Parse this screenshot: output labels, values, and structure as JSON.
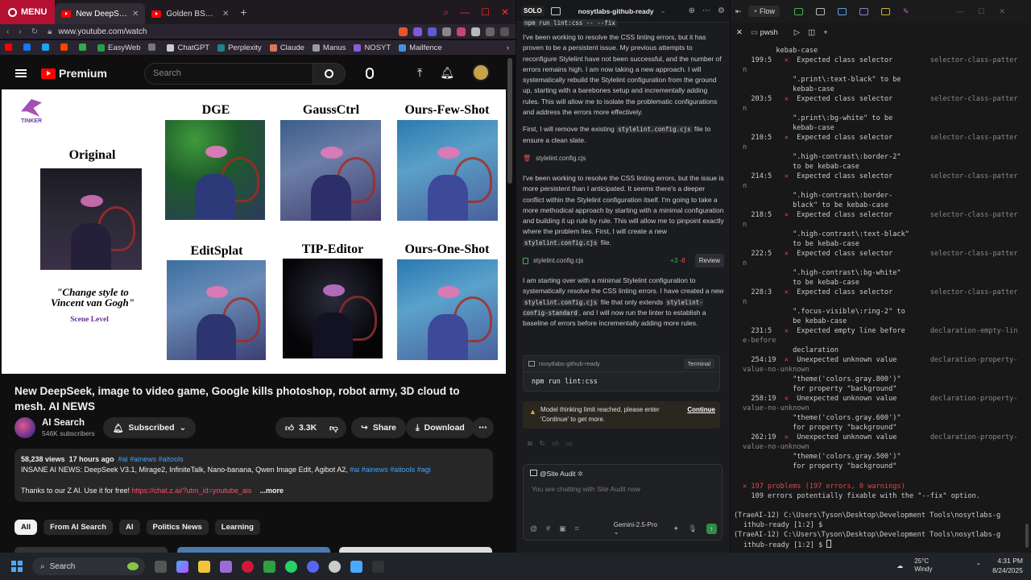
{
  "browser": {
    "menu_label": "MENU",
    "tabs": [
      {
        "title": "New DeepSeek, image"
      },
      {
        "title": "Golden BSP X Teo Laza"
      }
    ],
    "url": "www.youtube.com/watch",
    "bookmarks": [
      "EasyWeb",
      "ChatGPT",
      "Perplexity",
      "Claude",
      "Manus",
      "NOSYT",
      "Mailfence"
    ]
  },
  "youtube": {
    "logo_text": "Premium",
    "search_placeholder": "Search",
    "figure": {
      "brand": "TINKER",
      "original_label": "Original",
      "methods": [
        "DGE",
        "GaussCtrl",
        "Ours-Few-Shot",
        "EditSplat",
        "TIP-Editor",
        "Ours-One-Shot"
      ],
      "quote": "\"Change style to Vincent van Gogh\"",
      "scene_level": "Scene Level"
    },
    "video_title": "New DeepSeek, image to video game, Google kills photoshop, robot army, 3D cloud to mesh. AI NEWS",
    "channel": {
      "name": "AI Search",
      "subscribers": "546K subscribers",
      "subscribed_label": "Subscribed"
    },
    "actions": {
      "likes": "3.3K",
      "share": "Share",
      "download": "Download"
    },
    "description": {
      "views": "58,238 views",
      "age": "17 hours ago",
      "tags_line": "#ai #ainews #aitools",
      "text": "INSANE AI NEWS: DeepSeek V3.1, Mirage2, InfiniteTalk, Nano-banana, Qwen Image Edit, Agibot A2,",
      "tags_inline": "#ai #ainews #aitools #agi",
      "thanks": "Thanks to our Z AI. Use it for free!",
      "link": "https://chat.z.ai/?utm_id=youtube_ais",
      "more": "...more"
    },
    "chips": [
      "All",
      "From AI Search",
      "AI",
      "Politics News",
      "Learning"
    ]
  },
  "trae": {
    "solo": "SOLO",
    "repo": "nosytlabs-github-ready",
    "top_cmd": "npm run lint:css -- --fix",
    "p1": "I've been working to resolve the CSS linting errors, but it has proven to be a persistent issue. My previous attempts to reconfigure Stylelint have not been successful, and the number of errors remains high. I am now taking a new approach. I will systematically rebuild the Stylelint configuration from the ground up, starting with a barebones setup and incrementally adding rules. This will allow me to isolate the problematic configurations and address the errors more effectively.",
    "p2a": "First, I will remove the existing",
    "p2code": "stylelint.config.cjs",
    "p2b": "file to ensure a clean slate.",
    "file1": "stylelint.config.cjs",
    "p3a": "I've been working to resolve the CSS linting errors, but the issue is more persistent than I anticipated. It seems there's a deeper conflict within the Stylelint configuration itself. I'm going to take a more methodical approach by starting with a minimal configuration and building it up rule by rule. This will allow me to pinpoint exactly where the problem lies. First, I will create a new",
    "p3code": "stylelint.config.cjs",
    "p3b": "file.",
    "file2": "stylelint.config.cjs",
    "diff_add": "+3",
    "diff_del": "-8",
    "review": "Review",
    "p4a": "I am starting over with a minimal Stylelint configuration to systematically resolve the CSS linting errors. I have created a new",
    "p4code1": "stylelint.config.cjs",
    "p4b": "file that only extends",
    "p4code2": "stylelint-config-standard",
    "p4c": ", and I will now run the linter to establish a baseline of errors before incrementally adding more rules.",
    "term_card_repo": "nosytlabs-github-ready",
    "term_card_label": "Terminal",
    "term_card_cmd": "npm run lint:css",
    "warn": "Model thinking limit reached, please enter 'Continue' to get more.",
    "continue": "Continue",
    "input_agent": "@Site Audit",
    "input_placeholder": "You are chatting with Site Audit now",
    "model": "Gemini-2.5-Pro"
  },
  "terminal": {
    "flow": "Flow",
    "tab": "pwsh",
    "lines": [
      {
        "t": "        kebab-case",
        "c": ""
      },
      {
        "t": "  199:5   ✕  Expected class selector         selector-class-patter",
        "c": "err"
      },
      {
        "t": "n",
        "c": "rule"
      },
      {
        "t": "            \".print\\:text-black\" to be",
        "c": ""
      },
      {
        "t": "            kebab-case",
        "c": ""
      },
      {
        "t": "  203:5   ✕  Expected class selector         selector-class-patter",
        "c": "err"
      },
      {
        "t": "n",
        "c": "rule"
      },
      {
        "t": "            \".print\\:bg-white\" to be",
        "c": ""
      },
      {
        "t": "            kebab-case",
        "c": ""
      },
      {
        "t": "  210:5   ✕  Expected class selector         selector-class-patter",
        "c": "err"
      },
      {
        "t": "n",
        "c": "rule"
      },
      {
        "t": "            \".high-contrast\\:border-2\"",
        "c": ""
      },
      {
        "t": "            to be kebab-case",
        "c": ""
      },
      {
        "t": "  214:5   ✕  Expected class selector         selector-class-patter",
        "c": "err"
      },
      {
        "t": "n",
        "c": "rule"
      },
      {
        "t": "            \".high-contrast\\:border-",
        "c": ""
      },
      {
        "t": "            black\" to be kebab-case",
        "c": ""
      },
      {
        "t": "  218:5   ✕  Expected class selector         selector-class-patter",
        "c": "err"
      },
      {
        "t": "n",
        "c": "rule"
      },
      {
        "t": "            \".high-contrast\\:text-black\"",
        "c": ""
      },
      {
        "t": "            to be kebab-case",
        "c": ""
      },
      {
        "t": "  222:5   ✕  Expected class selector         selector-class-patter",
        "c": "err"
      },
      {
        "t": "n",
        "c": "rule"
      },
      {
        "t": "            \".high-contrast\\:bg-white\"",
        "c": ""
      },
      {
        "t": "            to be kebab-case",
        "c": ""
      },
      {
        "t": "  228:3   ✕  Expected class selector         selector-class-patter",
        "c": "err"
      },
      {
        "t": "n",
        "c": "rule"
      },
      {
        "t": "            \".focus-visible\\:ring-2\" to",
        "c": ""
      },
      {
        "t": "            be kebab-case",
        "c": ""
      },
      {
        "t": "  231:5   ✕  Expected empty line before      declaration-empty-lin",
        "c": "err"
      },
      {
        "t": "e-before",
        "c": "rule"
      },
      {
        "t": "            declaration",
        "c": ""
      },
      {
        "t": "  254:19  ✕  Unexpected unknown value        declaration-property-",
        "c": "err"
      },
      {
        "t": "value-no-unknown",
        "c": "rule"
      },
      {
        "t": "            \"theme('colors.gray.800')\"",
        "c": ""
      },
      {
        "t": "            for property \"background\"",
        "c": ""
      },
      {
        "t": "  258:19  ✕  Unexpected unknown value        declaration-property-",
        "c": "err"
      },
      {
        "t": "value-no-unknown",
        "c": "rule"
      },
      {
        "t": "            \"theme('colors.gray.600')\"",
        "c": ""
      },
      {
        "t": "            for property \"background\"",
        "c": ""
      },
      {
        "t": "  262:19  ✕  Unexpected unknown value        declaration-property-",
        "c": "err"
      },
      {
        "t": "value-no-unknown",
        "c": "rule"
      },
      {
        "t": "            \"theme('colors.gray.500')\"",
        "c": ""
      },
      {
        "t": "            for property \"background\"",
        "c": ""
      }
    ],
    "summary1": "✕ 197 problems (197 errors, 0 warnings)",
    "summary2": "  109 errors potentially fixable with the \"--fix\" option.",
    "prompt1": "(TraeAI-12) C:\\Users\\Tyson\\Desktop\\Development Tools\\nosytlabs-g",
    "prompt1b": "ithub-ready [1:2] $",
    "prompt2": "(TraeAI-12) C:\\Users\\Tyson\\Desktop\\Development Tools\\nosytlabs-g",
    "prompt2b": "ithub-ready [1:2] $ "
  },
  "taskbar": {
    "search": "Search",
    "temp": "25°C",
    "weather": "Windy",
    "time": "4:31 PM",
    "date": "8/24/2025"
  }
}
